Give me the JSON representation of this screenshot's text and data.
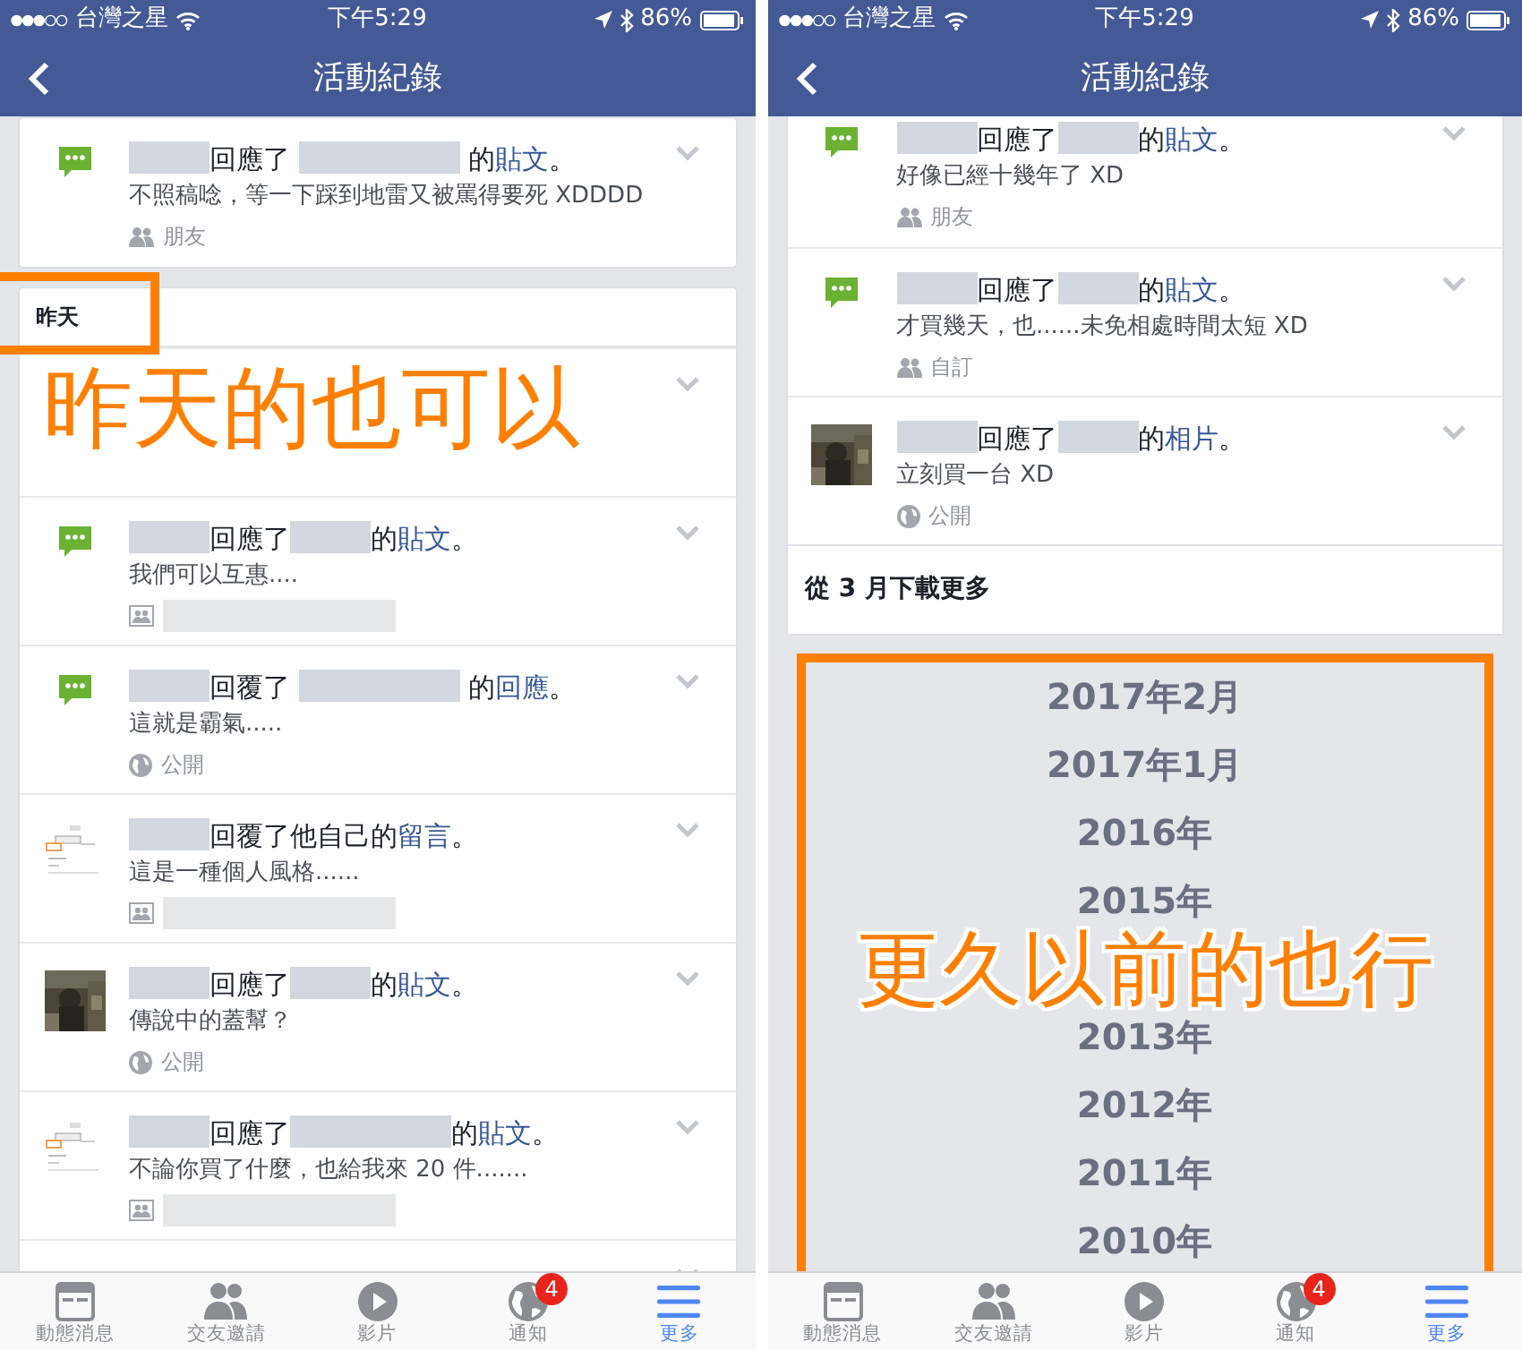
{
  "screens": [
    {
      "status_bar": {
        "carrier": "台灣之星",
        "time": "下午5:29",
        "battery": "86%"
      },
      "title": "活動紀錄",
      "cards": [
        {
          "items": [
            {
              "kind": "comment",
              "headline": [
                {
                  "kind": "blur_short"
                },
                {
                  "kind": "text",
                  "text": "回應了 "
                },
                {
                  "kind": "blur_long"
                },
                {
                  "kind": "text",
                  "text": " 的"
                },
                {
                  "kind": "link",
                  "text": "貼文"
                },
                {
                  "kind": "text",
                  "text": "。"
                }
              ],
              "body": "不照稿唸，等一下踩到地雷又被罵得要死 XDDDD",
              "audience": {
                "kind": "friends",
                "text": "朋友"
              }
            }
          ]
        },
        {
          "header": {
            "text": "昨天",
            "highlighted": true
          },
          "items": [
            {
              "kind": "callout",
              "text": "昨天的也可以"
            },
            {
              "kind": "comment",
              "headline": [
                {
                  "kind": "blur_short"
                },
                {
                  "kind": "text",
                  "text": "回應了"
                },
                {
                  "kind": "blur_short"
                },
                {
                  "kind": "text",
                  "text": "的"
                },
                {
                  "kind": "link",
                  "text": "貼文"
                },
                {
                  "kind": "text",
                  "text": "。"
                }
              ],
              "body": "我們可以互惠....",
              "audience": {
                "kind": "album"
              }
            },
            {
              "kind": "comment",
              "headline": [
                {
                  "kind": "blur_short"
                },
                {
                  "kind": "text",
                  "text": "回覆了 "
                },
                {
                  "kind": "blur_long"
                },
                {
                  "kind": "text",
                  "text": " 的"
                },
                {
                  "kind": "link",
                  "text": "回應"
                },
                {
                  "kind": "text",
                  "text": "。"
                }
              ],
              "body": "這就是霸氣.....",
              "audience": {
                "kind": "public",
                "text": "公開"
              }
            },
            {
              "kind": "screenshot",
              "headline": [
                {
                  "kind": "blur_short"
                },
                {
                  "kind": "text",
                  "text": "回覆了他自己的"
                },
                {
                  "kind": "link",
                  "text": "留言"
                },
                {
                  "kind": "text",
                  "text": "。"
                }
              ],
              "body": "這是一種個人風格......",
              "audience": {
                "kind": "album"
              }
            },
            {
              "headline": [
                {
                  "kind": "blur_short"
                },
                {
                  "kind": "text",
                  "text": "回應了"
                },
                {
                  "kind": "blur_short"
                },
                {
                  "kind": "text",
                  "text": "的"
                },
                {
                  "kind": "link",
                  "text": "貼文"
                },
                {
                  "kind": "text",
                  "text": "。"
                }
              ],
              "body": "傳說中的蓋幫？",
              "audience": {
                "kind": "public",
                "text": "公開"
              }
            },
            {
              "kind": "screenshot",
              "headline": [
                {
                  "kind": "blur_short"
                },
                {
                  "kind": "text",
                  "text": "回應了"
                },
                {
                  "kind": "blur_long"
                },
                {
                  "kind": "text",
                  "text": "的"
                },
                {
                  "kind": "link",
                  "text": "貼文"
                },
                {
                  "kind": "text",
                  "text": "。"
                }
              ],
              "body": "不論你買了什麼，也給我來 20 件.......",
              "audience": {
                "kind": "album"
              }
            },
            {
              "kind": "covered"
            }
          ]
        }
      ],
      "tabs": [
        {
          "kind": "news",
          "label": "動態消息",
          "selected": false
        },
        {
          "kind": "friends",
          "label": "交友邀請",
          "selected": false
        },
        {
          "kind": "video",
          "label": "影片",
          "selected": false
        },
        {
          "kind": "notifications",
          "label": "通知",
          "selected": false,
          "badge": "4"
        },
        {
          "kind": "more",
          "label": "更多",
          "selected": true
        }
      ]
    },
    {
      "status_bar": {
        "carrier": "台灣之星",
        "time": "下午5:29",
        "battery": "86%"
      },
      "title": "活動紀錄",
      "cards": [
        {
          "cut_top": true,
          "items": [
            {
              "kind": "comment",
              "headline": [
                {
                  "kind": "blur_short"
                },
                {
                  "kind": "text",
                  "text": "回應了"
                },
                {
                  "kind": "blur_short"
                },
                {
                  "kind": "text",
                  "text": "的"
                },
                {
                  "kind": "link",
                  "text": "貼文"
                },
                {
                  "kind": "text",
                  "text": "。"
                }
              ],
              "body": "好像已經十幾年了 XD",
              "audience": {
                "kind": "friends",
                "text": "朋友"
              }
            },
            {
              "kind": "comment",
              "headline": [
                {
                  "kind": "blur_short"
                },
                {
                  "kind": "text",
                  "text": "回應了"
                },
                {
                  "kind": "blur_short"
                },
                {
                  "kind": "text",
                  "text": "的"
                },
                {
                  "kind": "link",
                  "text": "貼文"
                },
                {
                  "kind": "text",
                  "text": "。"
                }
              ],
              "body": "才買幾天，也......未免相處時間太短 XD",
              "audience": {
                "kind": "friends",
                "text": "自訂"
              }
            },
            {
              "headline": [
                {
                  "kind": "blur_short"
                },
                {
                  "kind": "text",
                  "text": "回應了"
                },
                {
                  "kind": "blur_short"
                },
                {
                  "kind": "text",
                  "text": "的"
                },
                {
                  "kind": "link",
                  "text": "相片"
                },
                {
                  "kind": "text",
                  "text": "。"
                }
              ],
              "body": "立刻買一台 XD",
              "audience": {
                "kind": "public",
                "text": "公開"
              }
            }
          ],
          "footer": "從 3 月下載更多"
        }
      ],
      "year_list": {
        "highlighted": true,
        "rows": [
          {
            "kind": "year",
            "text": "2017年2月"
          },
          {
            "kind": "year",
            "text": "2017年1月"
          },
          {
            "kind": "year",
            "text": "2016年"
          },
          {
            "kind": "year",
            "text": "2015年"
          },
          {
            "kind": "callout",
            "text": "更久以前的也行"
          },
          {
            "kind": "year",
            "text": "2013年"
          },
          {
            "kind": "year",
            "text": "2012年"
          },
          {
            "kind": "year",
            "text": "2011年"
          },
          {
            "kind": "year",
            "text": "2010年"
          }
        ]
      },
      "tabs": [
        {
          "kind": "news",
          "label": "動態消息",
          "selected": false
        },
        {
          "kind": "friends",
          "label": "交友邀請",
          "selected": false
        },
        {
          "kind": "video",
          "label": "影片",
          "selected": false
        },
        {
          "kind": "notifications",
          "label": "通知",
          "selected": false,
          "badge": "4"
        },
        {
          "kind": "more",
          "label": "更多",
          "selected": true
        }
      ]
    }
  ]
}
